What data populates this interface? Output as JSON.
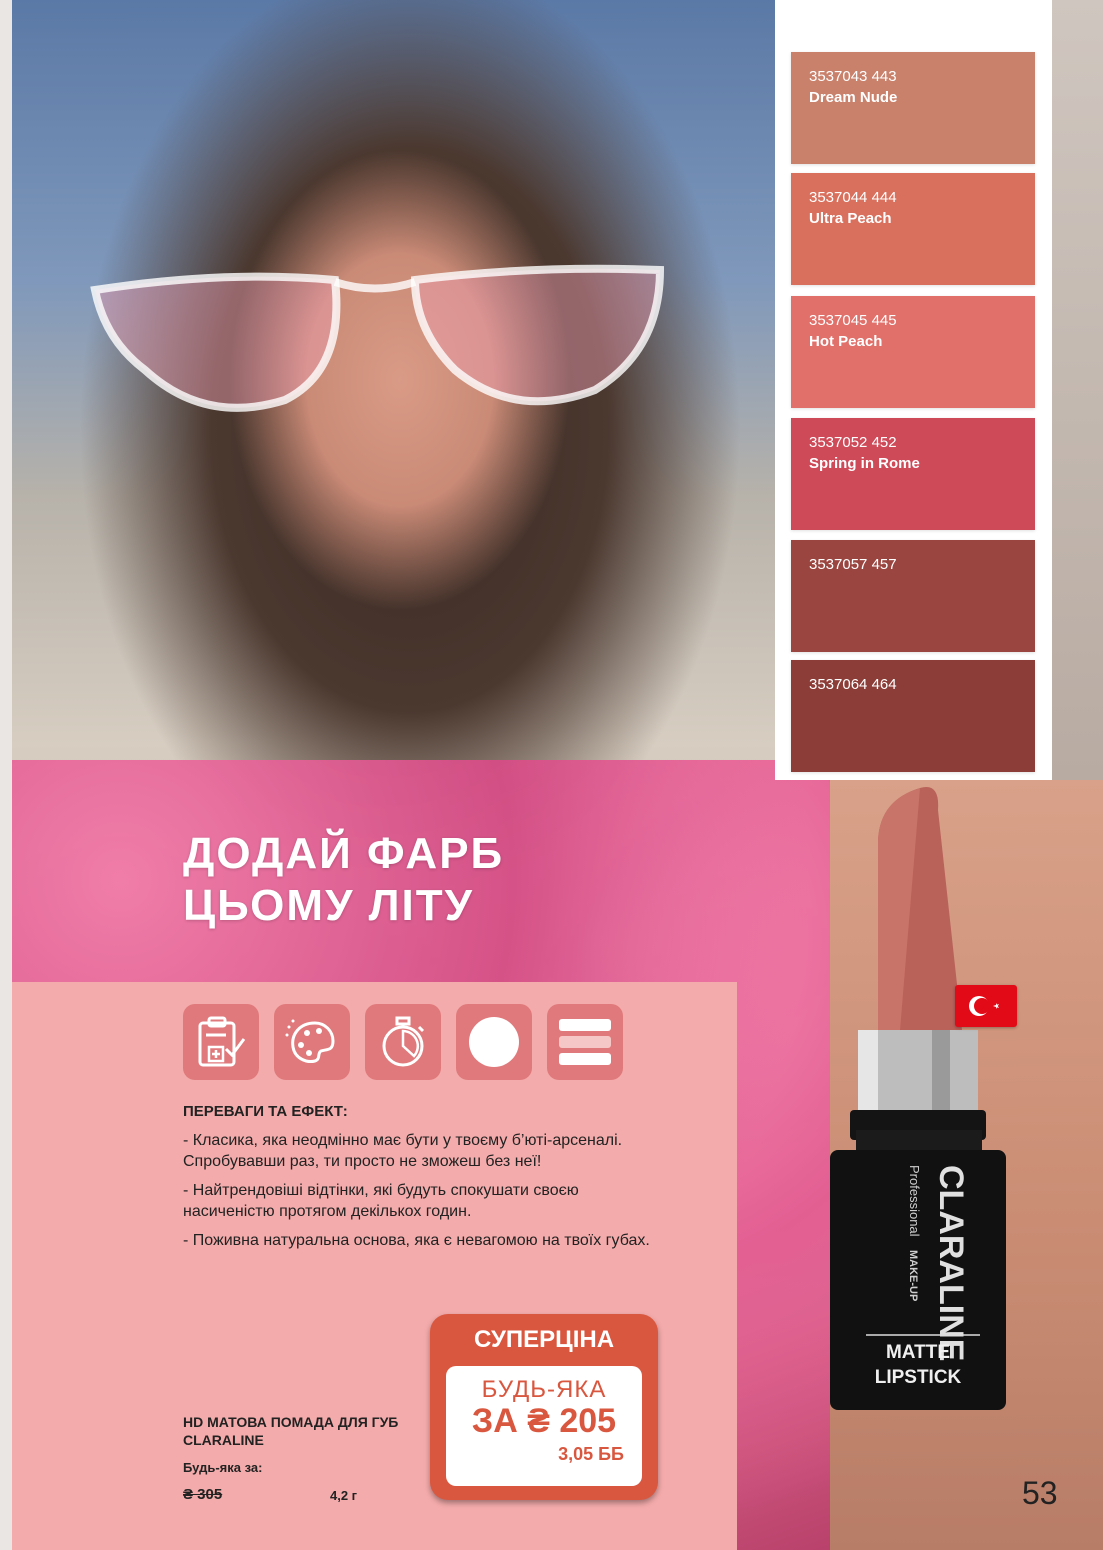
{
  "swatches": [
    {
      "code": "3537043 443",
      "name": "Dream Nude",
      "color": "#c9816c"
    },
    {
      "code": "3537044 444",
      "name": "Ultra Peach",
      "color": "#d9705e"
    },
    {
      "code": "3537045 445",
      "name": "Hot Peach",
      "color": "#e1706a"
    },
    {
      "code": "3537052 452",
      "name": "Spring in Rome",
      "color": "#cf4a58"
    },
    {
      "code": "3537057 457",
      "name": "",
      "color": "#9b4540"
    },
    {
      "code": "3537064 464",
      "name": "",
      "color": "#8c3d38"
    }
  ],
  "headline": {
    "line1": "ДОДАЙ ФАРБ",
    "line2": "ЦЬОМУ ЛІТУ"
  },
  "benefits": {
    "title": "ПЕРЕВАГИ ТА ЕФЕКТ:",
    "items": [
      "- Класика, яка неодмінно має бути у твоєму б’юті-арсеналі. Спробувавши раз, ти просто не зможеш без неї!",
      "- Найтрендовіші відтінки, які будуть спокушати своєю насиченістю протягом декількох годин.",
      "- Поживна натуральна основа, яка є невагомою на твоїх губах."
    ]
  },
  "product": {
    "name": "HD МАТОВА ПОМАДА ДЛЯ ГУБ CLARALINE",
    "any_for": "Будь-яка за:",
    "old_price": "₴ 305",
    "weight": "4,2 г"
  },
  "badge": {
    "title": "СУПЕРЦІНА",
    "any": "БУДЬ-ЯКА",
    "price": "ЗА ₴ 205",
    "points": "3,05 ББ"
  },
  "lipstick": {
    "brand": "CLARALINE",
    "sub1": "Professional",
    "sub2": "MAKE-UP",
    "matte": "MATTE",
    "lipstick": "LIPSTICK",
    "color": "#b9625a"
  },
  "icons": [
    "clipboard-check-icon",
    "palette-icon",
    "stopwatch-icon",
    "circle-icon",
    "layers-icon"
  ],
  "page_number": "53"
}
